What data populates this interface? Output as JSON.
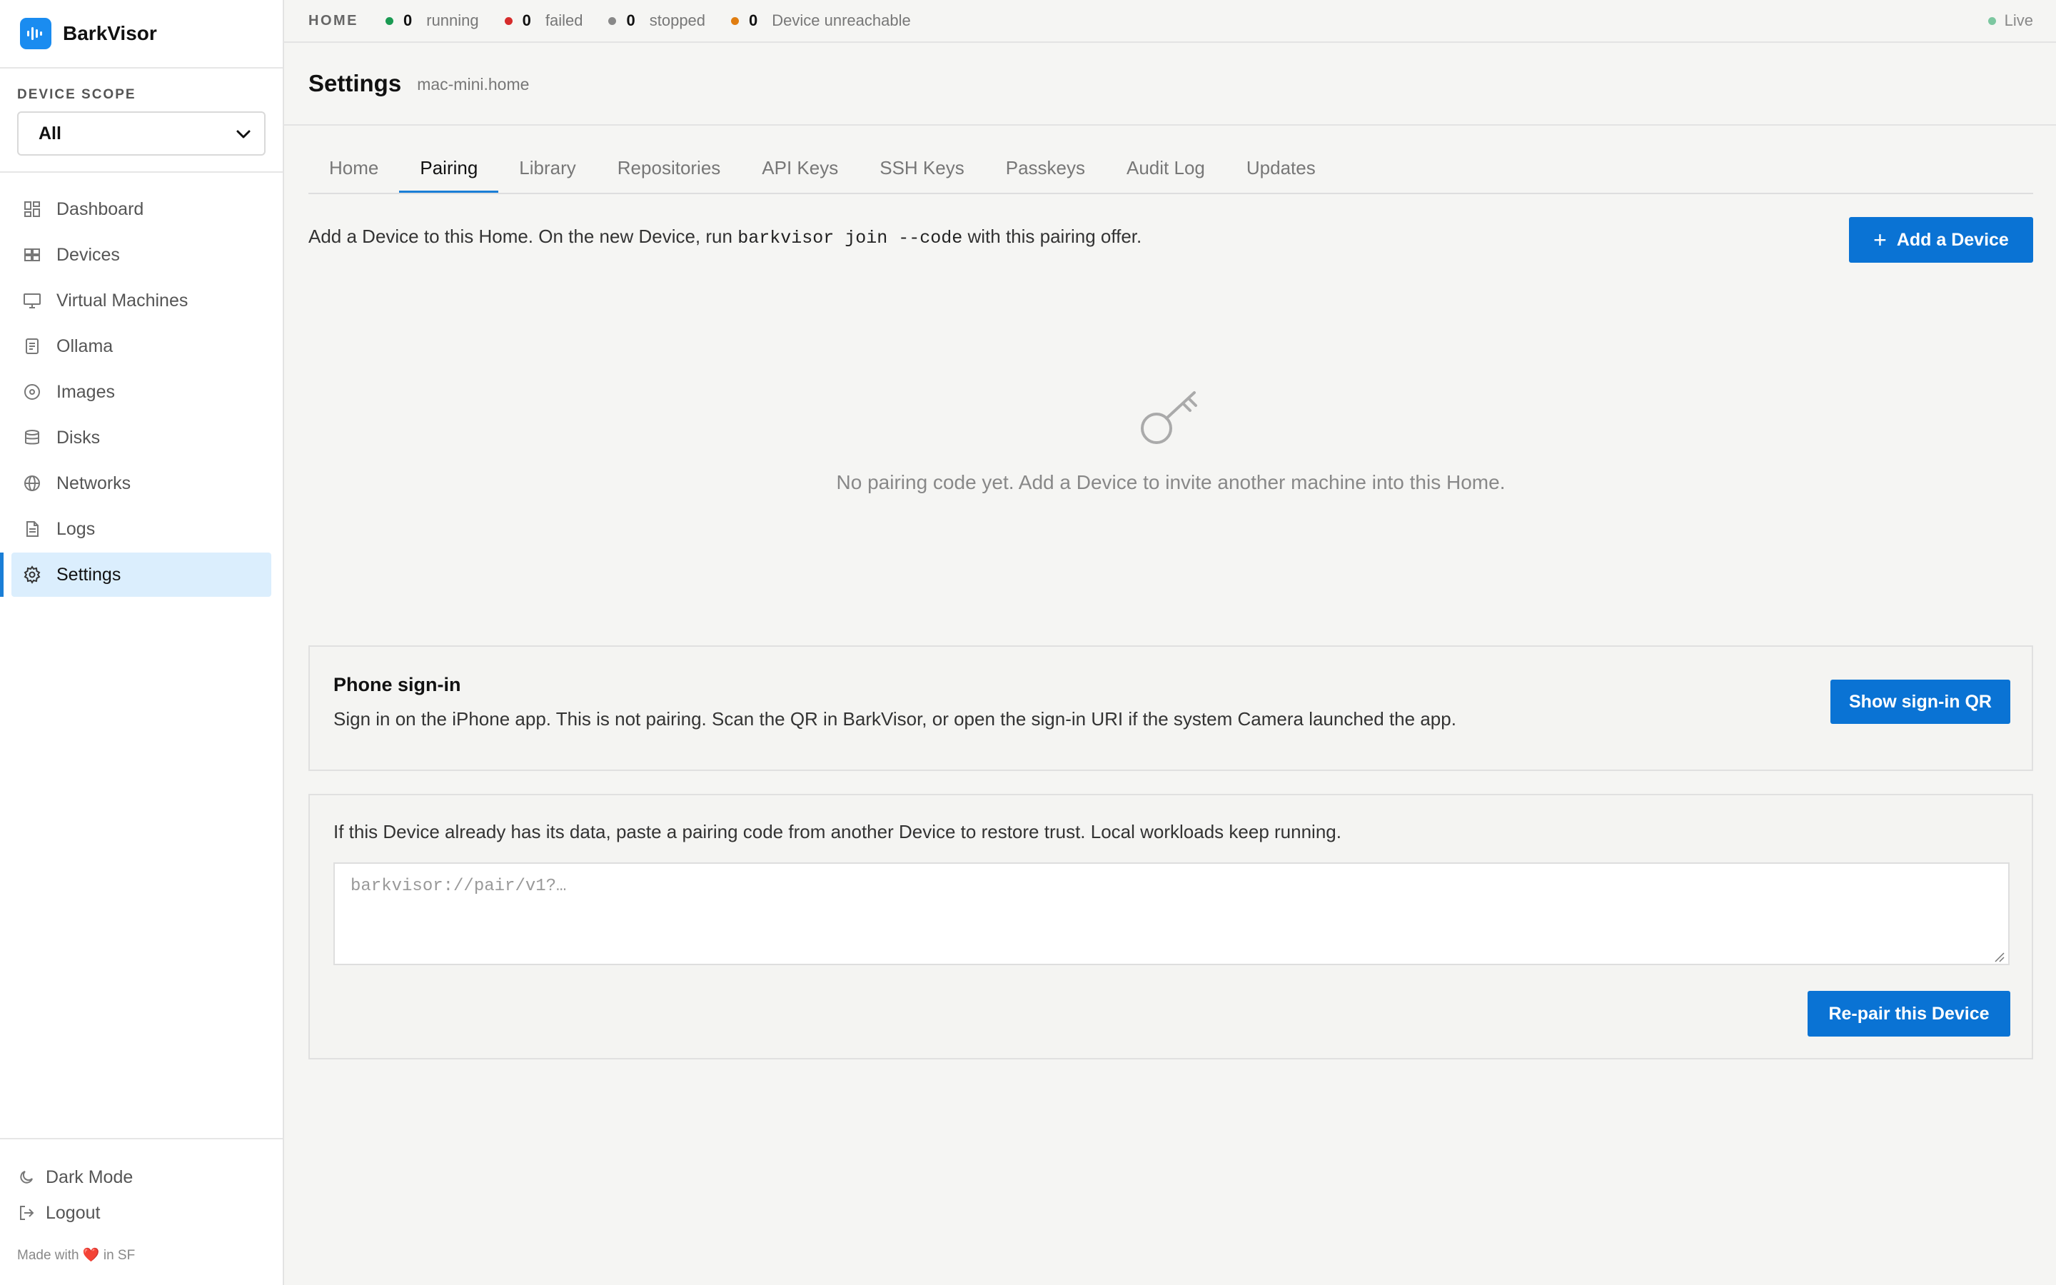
{
  "app": {
    "name": "BarkVisor"
  },
  "sidebar": {
    "scope_label": "DEVICE SCOPE",
    "scope_value": "All",
    "items": [
      {
        "label": "Dashboard",
        "icon": "dashboard-icon"
      },
      {
        "label": "Devices",
        "icon": "devices-icon"
      },
      {
        "label": "Virtual Machines",
        "icon": "monitor-icon"
      },
      {
        "label": "Ollama",
        "icon": "ollama-icon"
      },
      {
        "label": "Images",
        "icon": "disc-icon"
      },
      {
        "label": "Disks",
        "icon": "database-icon"
      },
      {
        "label": "Networks",
        "icon": "globe-icon"
      },
      {
        "label": "Logs",
        "icon": "file-text-icon"
      },
      {
        "label": "Settings",
        "icon": "gear-icon",
        "active": true
      }
    ],
    "footer": {
      "dark_mode": "Dark Mode",
      "logout": "Logout",
      "made_prefix": "Made with",
      "heart": "❤️",
      "made_suffix": "in SF"
    }
  },
  "status": {
    "home_label": "HOME",
    "running": {
      "count": "0",
      "label": "running",
      "color": "#1a9a52"
    },
    "failed": {
      "count": "0",
      "label": "failed",
      "color": "#d62b2b"
    },
    "stopped": {
      "count": "0",
      "label": "stopped",
      "color": "#888888"
    },
    "unreachable": {
      "count": "0",
      "label": "Device unreachable",
      "color": "#e07d10"
    },
    "live": {
      "label": "Live",
      "color": "#7cc7a0"
    }
  },
  "header": {
    "title": "Settings",
    "host": "mac-mini.home"
  },
  "tabs": [
    {
      "label": "Home"
    },
    {
      "label": "Pairing",
      "active": true
    },
    {
      "label": "Library"
    },
    {
      "label": "Repositories"
    },
    {
      "label": "API Keys"
    },
    {
      "label": "SSH Keys"
    },
    {
      "label": "Passkeys"
    },
    {
      "label": "Audit Log"
    },
    {
      "label": "Updates"
    }
  ],
  "pairing": {
    "intro_before": "Add a Device to this Home. On the new Device, run",
    "intro_code": "barkvisor join --code",
    "intro_after": "with this pairing offer.",
    "add_button": "Add a Device",
    "empty_text": "No pairing code yet. Add a Device to invite another machine into this Home."
  },
  "phone_signin": {
    "title": "Phone sign-in",
    "description": "Sign in on the iPhone app. This is not pairing. Scan the QR in BarkVisor, or open the sign-in URI if the system Camera launched the app.",
    "button": "Show sign-in QR"
  },
  "repair": {
    "description": "If this Device already has its data, paste a pairing code from another Device to restore trust. Local workloads keep running.",
    "placeholder": "barkvisor://pair/v1?…",
    "button": "Re-pair this Device"
  },
  "colors": {
    "accent": "#0a73d4",
    "active_nav_bg": "#dbeefd",
    "logo": "#1a8cf0"
  }
}
